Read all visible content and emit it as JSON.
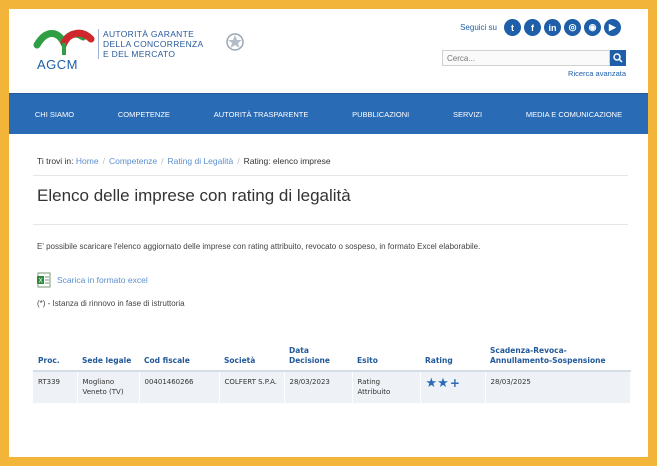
{
  "header": {
    "logo_text": "AGCM",
    "org_name_lines": [
      "AUTORITÀ GARANTE",
      "DELLA CONCORRENZA",
      "E DEL MERCATO"
    ],
    "follow_label": "Seguici su",
    "social_icons": [
      "twitter-icon",
      "facebook-icon",
      "linkedin-icon",
      "instagram-icon",
      "rss-icon",
      "youtube-icon"
    ],
    "search_placeholder": "Cerca...",
    "advanced_search": "Ricerca avanzata"
  },
  "nav": {
    "items": [
      "CHI SIAMO",
      "COMPETENZE",
      "AUTORITÀ TRASPARENTE",
      "PUBBLICAZIONI",
      "SERVIZI",
      "MEDIA E COMUNICAZIONE"
    ]
  },
  "breadcrumb": {
    "prefix": "Ti trovi in:",
    "links": [
      "Home",
      "Competenze",
      "Rating di Legalità"
    ],
    "current": "Rating: elenco imprese"
  },
  "page": {
    "title": "Elenco delle imprese con rating di legalità",
    "description": "E' possibile scaricare l'elenco aggiornato delle imprese con rating attribuito, revocato o sospeso, in formato Excel elaborabile.",
    "download_label": "Scarica in formato excel",
    "note": "(*) - Istanza di rinnovo in fase di istruttoria"
  },
  "table": {
    "headers": [
      "Proc.",
      "Sede legale",
      "Cod fiscale",
      "Società",
      "Data Decisione",
      "Esito",
      "Rating",
      "Scadenza-Revoca-Annullamento-Sospensione"
    ],
    "rows": [
      {
        "proc": "RT339",
        "sede": "Mogliano Veneto (TV)",
        "cod_fiscale": "00401460266",
        "societa": "COLFERT S.P.A.",
        "data_decisione": "28/03/2023",
        "esito": "Rating Attribuito",
        "rating_stars": 2,
        "rating_plus": true,
        "scadenza": "28/03/2025"
      }
    ]
  },
  "colors": {
    "frame_border": "#f3b43a",
    "nav_bg": "#2a6bb6",
    "brand_blue": "#1f5ea8",
    "brand_red": "#d0262d",
    "brand_green": "#2f9e44",
    "link": "#5b8fcf"
  }
}
